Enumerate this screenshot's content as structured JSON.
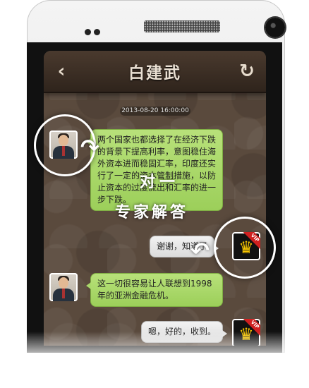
{
  "header": {
    "back_icon": "back-chevron-icon",
    "title": "白建武",
    "refresh_icon": "refresh-icon"
  },
  "chat": {
    "timestamp": "2013-08-20 16:00:00",
    "messages": [
      {
        "side": "left",
        "avatar": "expert-avatar",
        "text": "两个国家也都选择了在经济下跌的背景下提高利率，意图稳住海外资本进而稳固汇率，印度还实行了一定的资本管制措施，以防止资本的过度流出和汇率的进一步下跌。"
      },
      {
        "side": "right",
        "avatar": "vip-avatar",
        "text": "谢谢，知道了"
      },
      {
        "side": "left",
        "avatar": "expert-avatar",
        "text": "这一切很容易让人联想到1998年的亚洲金融危机。"
      },
      {
        "side": "right",
        "avatar": "vip-avatar",
        "text": "嗯，好的，收到。"
      }
    ]
  },
  "vip_badge": "VIP",
  "overlay": {
    "line1": "对一",
    "line2": "专家解答"
  },
  "colors": {
    "green_bubble": "#a9d86a",
    "gray_bubble": "#e6e6e6",
    "titlebar": "#3b2e24",
    "background": "#5a4a3d"
  }
}
